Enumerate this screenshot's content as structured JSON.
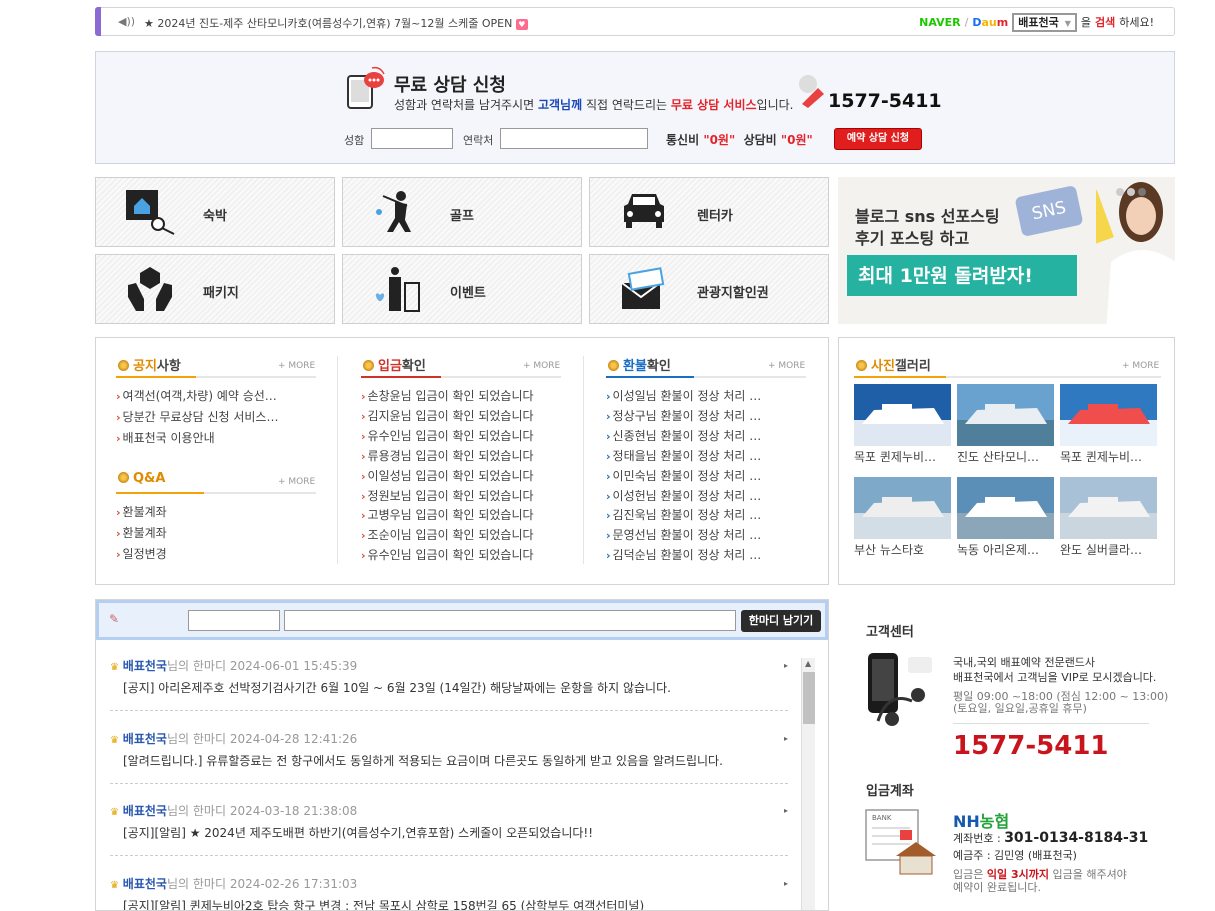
{
  "ticker": {
    "speaker_icon": "speaker-icon",
    "message": "★ 2024년 진도-제주 산타모니카호(여름성수기,연휴) 7월~12월 스케줄 OPEN",
    "heart_icon": "heart-icon",
    "naver": "NAVER",
    "divider": "/",
    "daum_d": "D",
    "daum_au": "au",
    "daum_m": "m",
    "site_name": "배표천국",
    "after1": "을",
    "search_word": "검색",
    "after2": "하세요!"
  },
  "consult": {
    "title": "무료 상담 신청",
    "sub_pre": "성함과 연락처를 남겨주시면",
    "sub_blue": "고객님께",
    "sub_mid": "직접 연락드리는",
    "sub_red": "무료 상담 서비스",
    "sub_post": "입니다.",
    "phone": "1577-5411",
    "name_label": "성함",
    "contact_label": "연락처",
    "fee1_label": "통신비",
    "fee1_value": "\"0원\"",
    "fee2_label": "상담비",
    "fee2_value": "\"0원\"",
    "reserve_button": "예약 상담 신청"
  },
  "categories": [
    {
      "label": "숙박",
      "icon": "lodging-icon"
    },
    {
      "label": "골프",
      "icon": "golf-icon"
    },
    {
      "label": "렌터카",
      "icon": "car-icon"
    },
    {
      "label": "패키지",
      "icon": "package-icon"
    },
    {
      "label": "이벤트",
      "icon": "event-icon"
    },
    {
      "label": "관광지할인권",
      "icon": "coupon-icon"
    }
  ],
  "banner": {
    "line1": "블로그 sns 선포스팅",
    "line2": "후기 포스팅 하고",
    "line3": "최대 1만원 돌려받자!",
    "sns_tag": "SNS"
  },
  "notice": {
    "title_o": "공지",
    "title_k": "사항",
    "more": "+ MORE",
    "items": [
      "여객선(여객,차량) 예약 승선…",
      "당분간 무료상담 신청 서비스…",
      "배표천국 이용안내"
    ]
  },
  "qna": {
    "title_o": "Q&A",
    "more": "+ MORE",
    "items": [
      "환불계좌",
      "환불계좌",
      "일정변경"
    ]
  },
  "deposit": {
    "title_o": "입금",
    "title_k": "확인",
    "more": "+ MORE",
    "items": [
      "손창윤님 입금이 확인 되었습니다",
      "김지윤님 입금이 확인 되었습니다",
      "유수인님 입금이 확인 되었습니다",
      "류용경님 입금이 확인 되었습니다",
      "이일성님 입금이 확인 되었습니다",
      "정원보님 입금이 확인 되었습니다",
      "고병우님 입금이 확인 되었습니다",
      "조순이님 입금이 확인 되었습니다",
      "유수인님 입금이 확인 되었습니다"
    ]
  },
  "refund": {
    "title_o": "환불",
    "title_k": "확인",
    "more": "+ MORE",
    "items": [
      "이성일님 환불이 정상 처리 …",
      "정상구님 환불이 정상 처리 …",
      "신종현님 환불이 정상 처리 …",
      "정태을님 환불이 정상 처리 …",
      "이민숙님 환불이 정상 처리 …",
      "이성헌님 환불이 정상 처리 …",
      "김진욱님 환불이 정상 처리 …",
      "문영선님 환불이 정상 처리 …",
      "김덕순님 환불이 정상 처리 …"
    ]
  },
  "gallery": {
    "title_o": "사진",
    "title_k": "갤러리",
    "more": "+ MORE",
    "items": [
      {
        "caption": "목포 퀸제누비…"
      },
      {
        "caption": "진도 산타모니…"
      },
      {
        "caption": "목포 퀸제누비…"
      },
      {
        "caption": "부산 뉴스타호"
      },
      {
        "caption": "녹동 아리온제…"
      },
      {
        "caption": "완도 실버클라…"
      }
    ]
  },
  "comments": {
    "leave_button": "한마디 남기기",
    "suffix": "님의 한마디",
    "items": [
      {
        "author": "배표천국",
        "date": "2024-06-01 15:45:39",
        "text": "[공지] 아리온제주호 선박정기검사기간 6월 10일 ~ 6월 23일 (14일간) 해당날짜에는 운항을 하지 않습니다."
      },
      {
        "author": "배표천국",
        "date": "2024-04-28 12:41:26",
        "text": "[알려드립니다.] 유류할증료는 전 항구에서도 동일하게 적용되는 요금이며 다른곳도 동일하게 받고 있음을 알려드립니다."
      },
      {
        "author": "배표천국",
        "date": "2024-03-18 21:38:08",
        "text": "[공지][알림] ★ 2024년 제주도배편 하반기(여름성수기,연휴포함) 스케줄이 오픈되었습니다!!"
      },
      {
        "author": "배표천국",
        "date": "2024-02-26 17:31:03",
        "text": "[공지][알림] 퀸제누비아2호 탑승 항구 변경 : 전남 목포시 삼학로 158번길 65 (삼학부두 여객선터미널)"
      }
    ]
  },
  "customer_center": {
    "title": "고객센터",
    "line1": "국내,국외 배표예약 전문랜드사",
    "line2": "배표천국에서 고객님을 VIP로 모시겠습니다.",
    "hours1": "평일 09:00 ~18:00 (점심 12:00 ~ 13:00)",
    "hours2": "(토요일, 일요일,공휴일 휴무)",
    "phone": "1577-5411"
  },
  "account": {
    "title": "입금계좌",
    "bank_nh": "NH",
    "bank_name": "농협",
    "number_label": "계좌번호 :",
    "number": "301-0134-8184-31",
    "owner": "예금주 : 김민영 (배표천국)",
    "note_pre": "입금은",
    "note_red": "익일 3시까지",
    "note_post": "입금을 해주셔야",
    "note2": "예약이 완료됩니다.",
    "bank_tag": "BANK"
  }
}
